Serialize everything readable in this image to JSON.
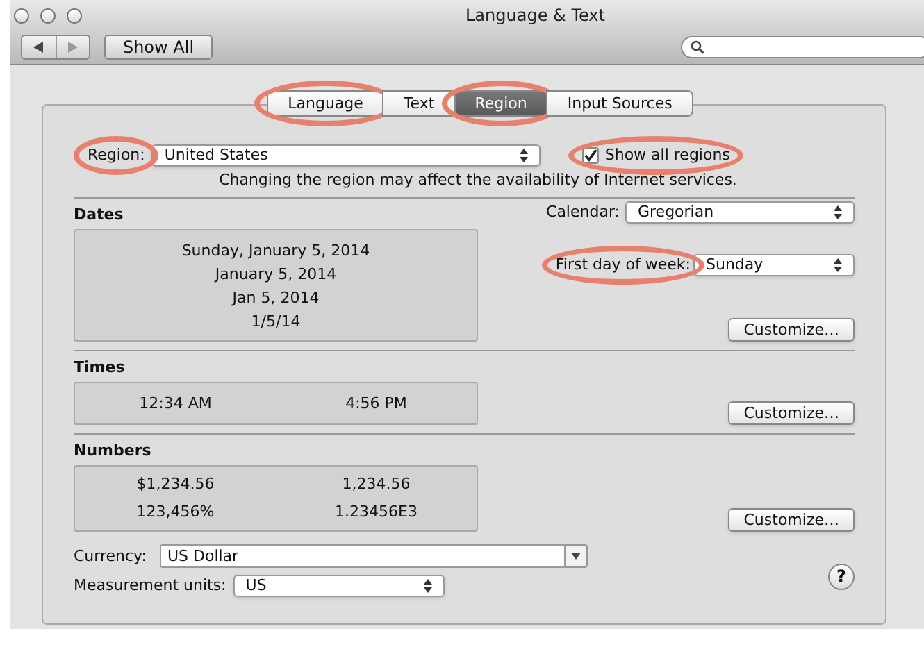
{
  "window": {
    "title": "Language & Text"
  },
  "toolbar": {
    "show_all": "Show All"
  },
  "tabs": [
    {
      "label": "Language",
      "selected": false,
      "highlighted": true
    },
    {
      "label": "Text",
      "selected": false,
      "highlighted": false
    },
    {
      "label": "Region",
      "selected": true,
      "highlighted": true
    },
    {
      "label": "Input Sources",
      "selected": false,
      "highlighted": false
    }
  ],
  "region": {
    "label": "Region:",
    "value": "United States",
    "highlighted": true
  },
  "show_all_regions": {
    "label": "Show all regions",
    "checked": true,
    "highlighted": true
  },
  "notice": "Changing the region may affect the availability of Internet services.",
  "dates": {
    "heading": "Dates",
    "samples": [
      "Sunday, January 5, 2014",
      "January 5, 2014",
      "Jan 5, 2014",
      "1/5/14"
    ],
    "calendar": {
      "label": "Calendar:",
      "value": "Gregorian"
    },
    "first_day": {
      "label": "First day of week:",
      "value": "Sunday",
      "highlighted": true
    },
    "customize": "Customize…"
  },
  "times": {
    "heading": "Times",
    "samples": [
      "12:34 AM",
      "4:56 PM"
    ],
    "customize": "Customize…"
  },
  "numbers": {
    "heading": "Numbers",
    "samples": [
      "$1,234.56",
      "1,234.56",
      "123,456%",
      "1.23456E3"
    ],
    "customize": "Customize…"
  },
  "currency": {
    "label": "Currency:",
    "value": "US Dollar"
  },
  "measurement": {
    "label": "Measurement units:",
    "value": "US"
  },
  "help": "?"
}
